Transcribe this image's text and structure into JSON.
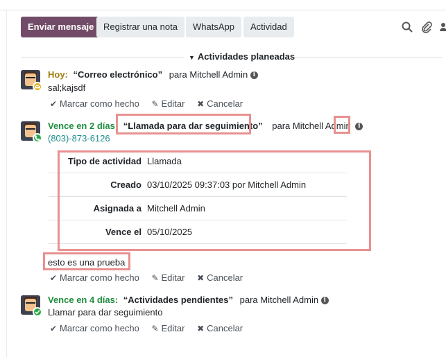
{
  "toolbar": {
    "send_message": "Enviar mensaje",
    "log_note": "Registrar una nota",
    "whatsapp": "WhatsApp",
    "activity": "Actividad",
    "icons": [
      "search-icon",
      "paperclip-icon",
      "followers-icon"
    ]
  },
  "section": {
    "title": "Actividades planeadas"
  },
  "activities": [
    {
      "status": "Hoy:",
      "summary": "“Correo electrónico”",
      "assignee": "para Mitchell Admin",
      "note": "sal;kajsdf",
      "badge_color": "#e0a800",
      "badge_icon": "envelope-icon"
    },
    {
      "status": "Vence en 2 días:",
      "summary": "“Llamada para dar seguimiento”",
      "assignee": "para Mitchell Admin",
      "phone": "(803)-873-6126",
      "badge_color": "#28a745",
      "badge_icon": "phone-icon",
      "details": [
        {
          "label": "Tipo de actividad",
          "value": "Llamada"
        },
        {
          "label": "Creado",
          "value": "03/10/2025 09:37:03 por Mitchell Admin"
        },
        {
          "label": "Asignada a",
          "value": "Mitchell Admin"
        },
        {
          "label": "Vence el",
          "value": "05/10/2025"
        }
      ],
      "note": "esto es una prueba"
    },
    {
      "status": "Vence en 4 días:",
      "summary": "“Actividades pendientes”",
      "assignee": "para Mitchell Admin",
      "note": "Llamar para dar seguimiento",
      "badge_color": "#28a745",
      "badge_icon": "check-icon"
    }
  ],
  "actions": {
    "mark_done": "Marcar como hecho",
    "edit": "Editar",
    "cancel": "Cancelar"
  }
}
